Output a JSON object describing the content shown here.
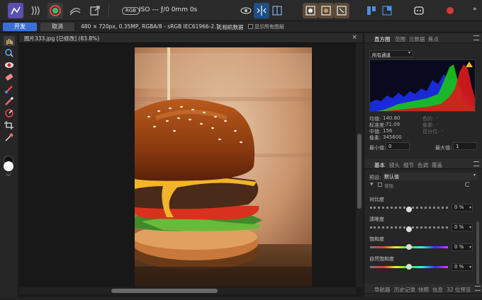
{
  "toolbar": {
    "color_mode_badge": "RGB",
    "camera_info": "ISO --- ƒ/0 0mm 0s",
    "more_label": "»"
  },
  "context": {
    "develop_button": "开发",
    "cancel_button": "取消",
    "image_info": "480 × 720px, 0.35MP, RGBA/8 - sRGB IEC61966-2.1",
    "no_camera_data": "无相机数据",
    "show_all_overlays": "显示所有图层"
  },
  "document": {
    "tab_title": "图片333.jpg [已修改] (83.8%)",
    "close_label": "×"
  },
  "histogram_panel": {
    "tabs": [
      "直方图",
      "范围",
      "元数据",
      "焦点"
    ],
    "active_tab": 0,
    "channel_select": "所有通道",
    "stats": {
      "mean_label": "均值:",
      "mean_value": "140.80",
      "stddev_label": "标准差:",
      "stddev_value": "71.09",
      "median_label": "中值:",
      "median_value": "156",
      "pixels_label": "像素:",
      "pixels_value": "345600",
      "level_label": "色阶:",
      "level_value": "-",
      "count_label": "像素:",
      "count_value": "-",
      "percentile_label": "百分位:",
      "percentile_value": "-"
    },
    "min_label": "最小值:",
    "min_value": "0",
    "max_label": "最大值:",
    "max_value": "1"
  },
  "basic_panel": {
    "tabs": [
      "基本",
      "镜头",
      "细节",
      "色调",
      "覆盖"
    ],
    "active_tab": 0,
    "preset_label": "预设:",
    "preset_value": "默认值",
    "partial_label": "增强",
    "adjustments": [
      {
        "label": "对比度",
        "value": "0 %",
        "knob": 0.5
      },
      {
        "label": "清晰度",
        "value": "0 %",
        "knob": 0.5
      },
      {
        "label": "饱和度",
        "value": "0 %",
        "knob": 0.5
      },
      {
        "label": "自然饱和度",
        "value": "0 %",
        "knob": 0.5
      }
    ]
  },
  "bottom_panel": {
    "tabs": [
      "导航器",
      "历史记录",
      "快照",
      "信息",
      "32 位预览"
    ]
  },
  "colors": {
    "accent": "#3a6fd8",
    "panel_bg": "#262626"
  }
}
